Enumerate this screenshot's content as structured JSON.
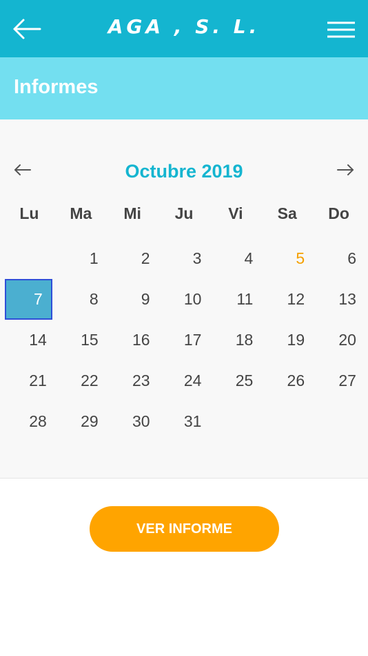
{
  "appbar": {
    "brand": "AGA , S. L.",
    "back_icon": "arrow-left-icon",
    "menu_icon": "hamburger-menu-icon"
  },
  "section": {
    "title": "Informes"
  },
  "calendar": {
    "month_label": "Octubre 2019",
    "prev_icon": "arrow-left-icon",
    "next_icon": "arrow-right-icon",
    "weekdays": [
      "Lu",
      "Ma",
      "Mi",
      "Ju",
      "Vi",
      "Sa",
      "Do"
    ],
    "weeks": [
      [
        "",
        "1",
        "2",
        "3",
        "4",
        "5",
        "6"
      ],
      [
        "7",
        "8",
        "9",
        "10",
        "11",
        "12",
        "13"
      ],
      [
        "14",
        "15",
        "16",
        "17",
        "18",
        "19",
        "20"
      ],
      [
        "21",
        "22",
        "23",
        "24",
        "25",
        "26",
        "27"
      ],
      [
        "28",
        "29",
        "30",
        "31",
        "",
        "",
        ""
      ]
    ],
    "selected_day": "7",
    "highlighted_day": "5"
  },
  "actions": {
    "view_report_label": "VER INFORME"
  },
  "colors": {
    "appbar": "#14b5d0",
    "section_bar": "#73dff0",
    "accent_button": "#ffa400",
    "highlighted_day": "#f5a000",
    "selected_day_bg": "#4bafd0",
    "selected_day_border": "#2f4fd8"
  }
}
